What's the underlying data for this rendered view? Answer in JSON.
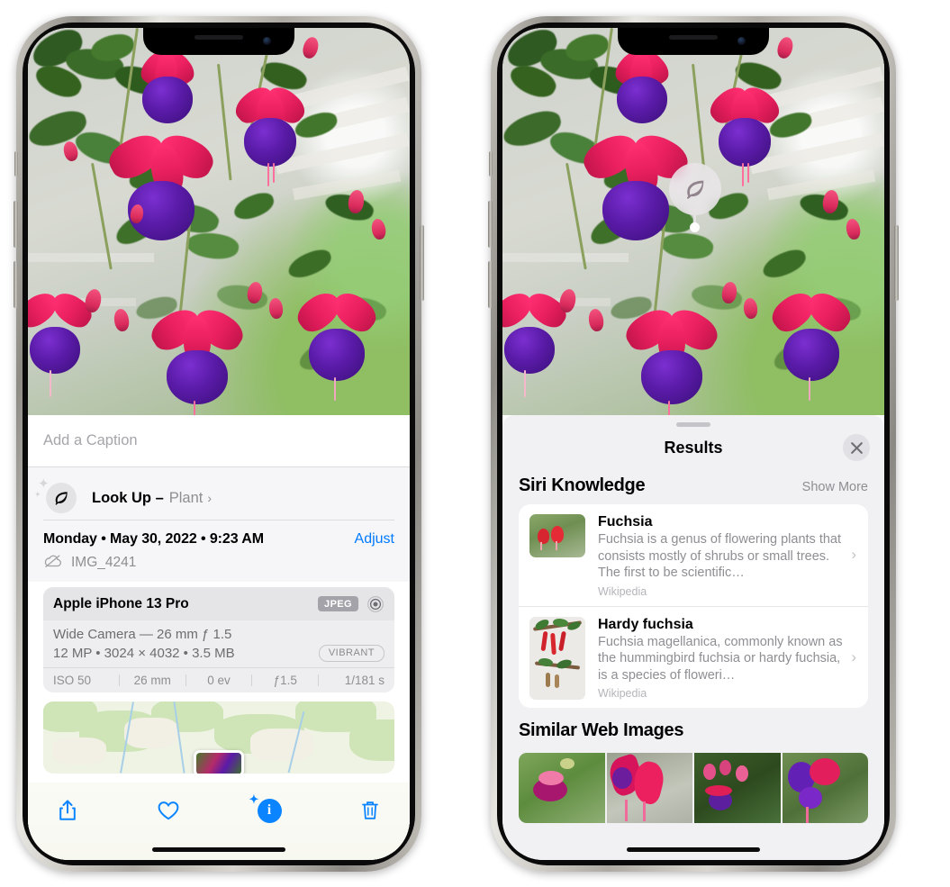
{
  "left_phone": {
    "caption_field": {
      "placeholder": "Add a Caption",
      "value": ""
    },
    "lookup": {
      "label": "Look Up –",
      "subject": "Plant",
      "chevron": "›",
      "icon": "leaf-icon"
    },
    "info": {
      "date": "Monday • May 30, 2022 • 9:23 AM",
      "adjust_label": "Adjust",
      "filename": "IMG_4241",
      "cloud_icon": "cloud-slash-icon"
    },
    "exif": {
      "device": "Apple iPhone 13 Pro",
      "format_badge": "JPEG",
      "lens_icon": "aperture-icon",
      "lens_line": "Wide Camera — 26 mm ƒ 1.5",
      "size_line": "12 MP • 3024 × 4032 • 3.5 MB",
      "style_badge": "VIBRANT",
      "stats": [
        "ISO 50",
        "26 mm",
        "0 ev",
        "ƒ1.5",
        "1/181 s"
      ]
    },
    "toolbar": [
      {
        "name": "share-button",
        "icon": "share-icon",
        "active": false
      },
      {
        "name": "favorite-button",
        "icon": "heart-icon",
        "active": false
      },
      {
        "name": "info-button",
        "icon": "info-sparkle-icon",
        "active": true
      },
      {
        "name": "delete-button",
        "icon": "trash-icon",
        "active": false
      }
    ]
  },
  "right_phone": {
    "visual_lookup_badge": {
      "icon": "leaf-icon"
    },
    "sheet": {
      "title": "Results",
      "close_icon": "close-icon",
      "sections": [
        {
          "title": "Siri Knowledge",
          "action": "Show More",
          "cards": [
            {
              "title": "Fuchsia",
              "description": "Fuchsia is a genus of flowering plants that consists mostly of shrubs or small trees. The first to be scientific…",
              "source": "Wikipedia",
              "chevron": "›"
            },
            {
              "title": "Hardy fuchsia",
              "description": "Fuchsia magellanica, commonly known as the hummingbird fuchsia or hardy fuchsia, is a species of floweri…",
              "source": "Wikipedia",
              "chevron": "›"
            }
          ]
        },
        {
          "title": "Similar Web Images",
          "action": "",
          "thumbnails": [
            "web-image-1",
            "web-image-2",
            "web-image-3",
            "web-image-4"
          ]
        }
      ]
    }
  },
  "colors": {
    "accent_blue": "#007aff",
    "toolbar_blue": "#0a84ff",
    "sheet_gray": "#f1f1f4",
    "secondary_text": "#8e8e93",
    "flower_pink": "#e81f5e",
    "flower_purple": "#5a1ba8",
    "foliage_green": "#4e7a34"
  }
}
